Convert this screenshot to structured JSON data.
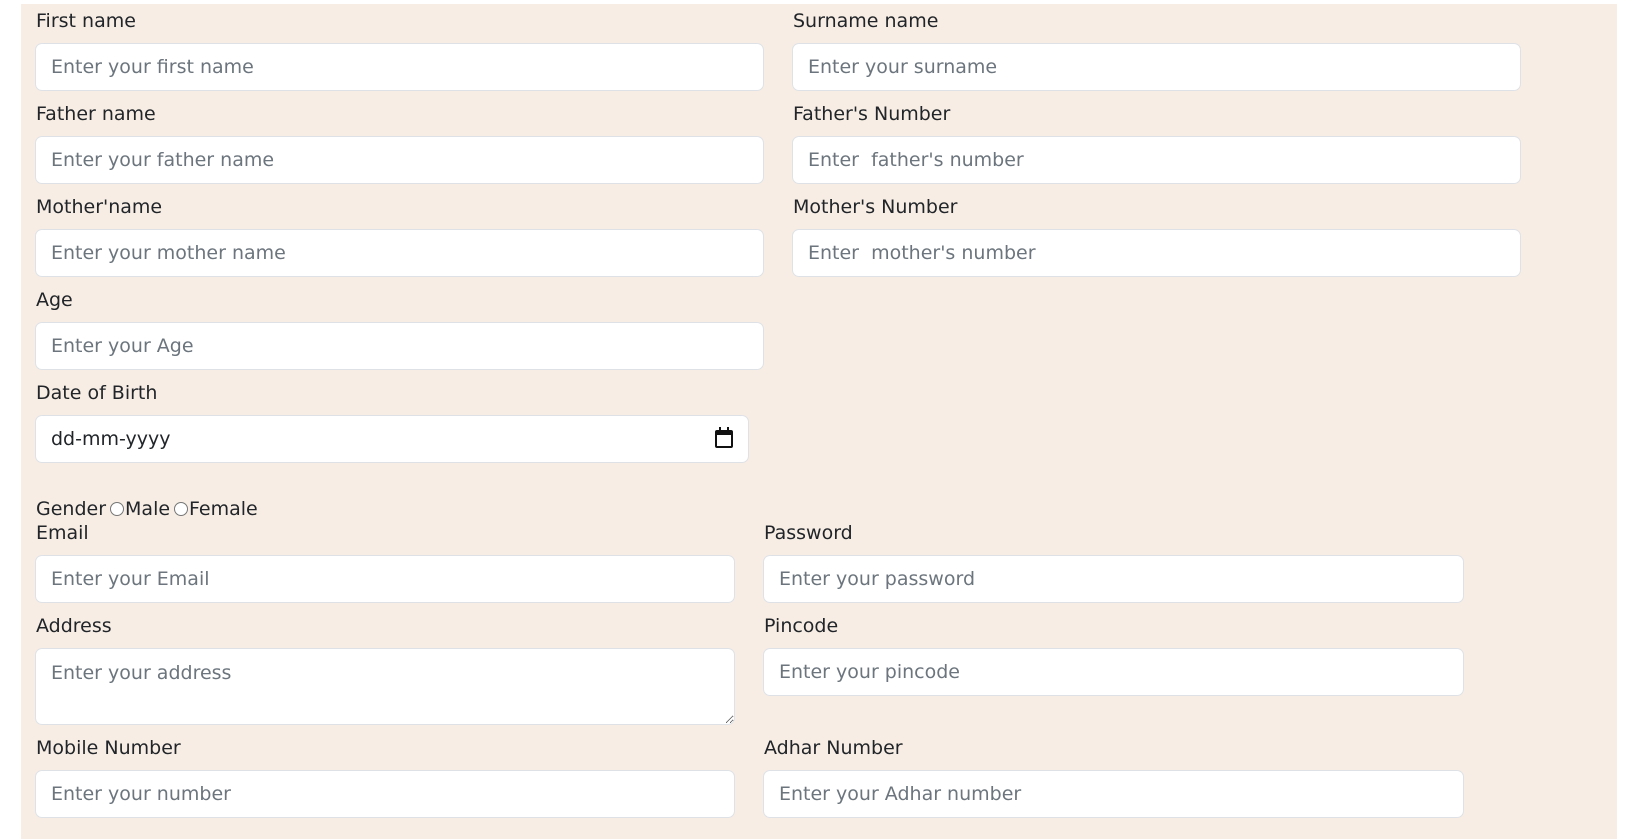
{
  "form": {
    "first_name": {
      "label": "First name",
      "placeholder": "Enter your first name"
    },
    "surname": {
      "label": "Surname name",
      "placeholder": "Enter your surname"
    },
    "father_name": {
      "label": "Father name",
      "placeholder": "Enter your father name"
    },
    "father_number": {
      "label": "Father's Number",
      "placeholder": "Enter  father's number"
    },
    "mother_name": {
      "label": "Mother'name",
      "placeholder": "Enter your mother name"
    },
    "mother_number": {
      "label": "Mother's Number",
      "placeholder": "Enter  mother's number"
    },
    "age": {
      "label": "Age",
      "placeholder": "Enter your Age"
    },
    "dob": {
      "label": "Date of Birth",
      "value": "dd-mm-yyyy",
      "icon": "calendar-icon"
    },
    "gender": {
      "label": "Gender",
      "options": [
        "Male",
        "Female"
      ]
    },
    "email": {
      "label": "Email",
      "placeholder": "Enter your Email"
    },
    "password": {
      "label": "Password",
      "placeholder": "Enter your password"
    },
    "address": {
      "label": "Address",
      "placeholder": "Enter your address"
    },
    "pincode": {
      "label": "Pincode",
      "placeholder": "Enter your pincode"
    },
    "mobile": {
      "label": "Mobile Number",
      "placeholder": "Enter your number"
    },
    "adhar": {
      "label": "Adhar Number",
      "placeholder": "Enter your Adhar number"
    }
  },
  "colors": {
    "panel_background": "#f7ede4",
    "input_border": "#dee2e6",
    "placeholder_text": "#6c757d"
  }
}
